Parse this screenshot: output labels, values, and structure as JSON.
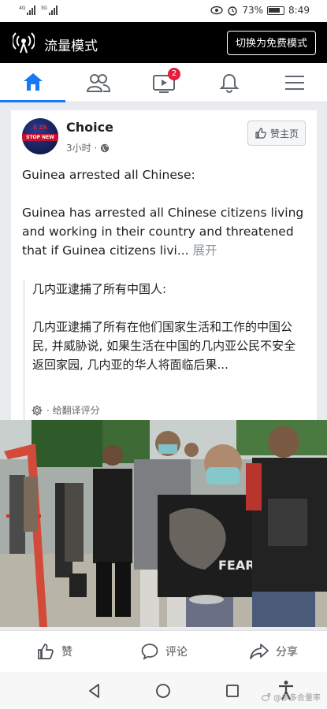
{
  "status_bar": {
    "signal_1": "4G",
    "signal_2": "3G",
    "battery_percent": "73%",
    "time": "8:49",
    "icons": [
      "eye-icon",
      "alarm-icon",
      "battery-icon"
    ]
  },
  "data_banner": {
    "title": "流量模式",
    "switch_button": "切换为免费模式"
  },
  "nav": {
    "tabs": [
      "home-icon",
      "friends-icon",
      "watch-icon",
      "notifications-icon",
      "menu-icon"
    ],
    "watch_badge": "2",
    "accent_color": "#1877f2"
  },
  "post": {
    "avatar_text_top": "E ZA",
    "avatar_text_stripe": "STOP NEW",
    "page_name": "Choice",
    "time": "3小时 ·",
    "like_page_button": "赞主页",
    "english_title": "Guinea arrested all Chinese:",
    "english_body": "Guinea has arrested all Chinese citizens living and working in their country and threatened that if Guinea citizens livi...",
    "see_more": "展开",
    "translation_title": "几内亚逮捕了所有中国人:",
    "translation_body": "几内亚逮捕了所有在他们国家生活和工作的中国公民, 并威胁说, 如果生活在中国的几内亚公民不安全返回家园, 几内亚的华人将面临后果...",
    "rate_translation": "· 给翻译评分",
    "photo_text": "FEAR"
  },
  "actions": {
    "like": "赞",
    "comment": "评论",
    "share": "分享"
  },
  "system_nav": {
    "watermark": "@多多合量率"
  }
}
